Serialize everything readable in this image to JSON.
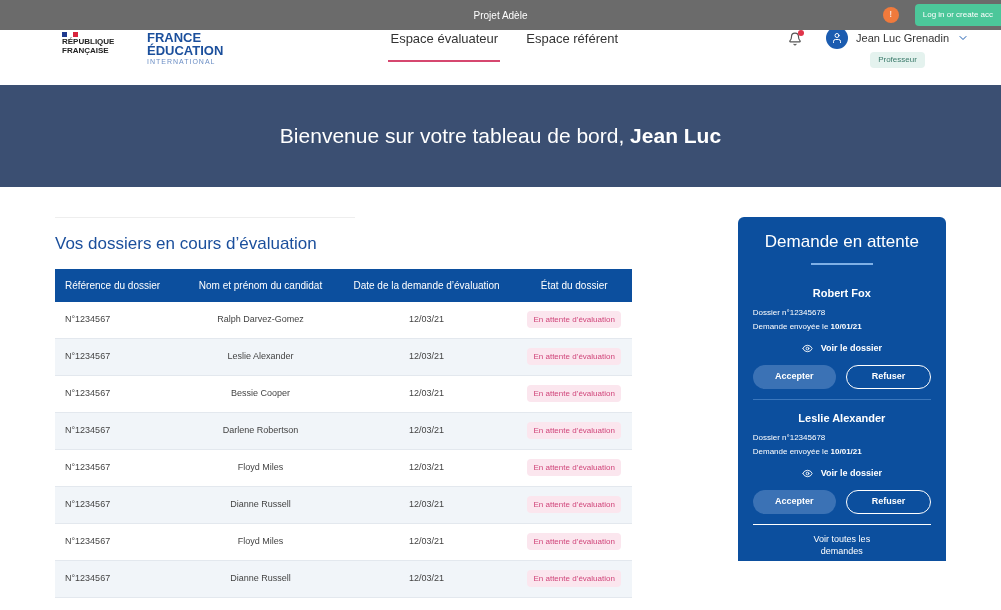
{
  "top_bar": {
    "title": "Projet Adèle",
    "badge": "!",
    "login_button": "Log in or create acc"
  },
  "header": {
    "logo_republique": [
      "RÉPUBLIQUE",
      "FRANÇAISE"
    ],
    "logo_fei": [
      "FRANCE",
      "ÉDUCATION",
      "INTERNATIONAL"
    ],
    "nav": [
      {
        "label": "Espace évaluateur",
        "selected": true
      },
      {
        "label": "Espace référent",
        "selected": false
      }
    ],
    "notifications": {
      "unread": true
    },
    "user": {
      "name": "Jean Luc Grenadin",
      "role": "Professeur"
    }
  },
  "hero": {
    "title": "Bienvenue sur votre tableau de bord, **Jean Luc**"
  },
  "dossiers": {
    "title": "Vos dossiers en cours d’évaluation",
    "columns": [
      "Référence du dossier",
      "Nom et prénom du candidat",
      "Date de la demande d’évaluation",
      "État du dossier"
    ],
    "rows": [
      {
        "ref": "N°1234567",
        "name": "Ralph Darvez-Gomez",
        "date": "12/03/21",
        "status": "En attente d’évaluation"
      },
      {
        "ref": "N°1234567",
        "name": "Leslie Alexander",
        "date": "12/03/21",
        "status": "En attente d’évaluation"
      },
      {
        "ref": "N°1234567",
        "name": "Bessie Cooper",
        "date": "12/03/21",
        "status": "En attente d’évaluation"
      },
      {
        "ref": "N°1234567",
        "name": "Darlene Robertson",
        "date": "12/03/21",
        "status": "En attente d’évaluation"
      },
      {
        "ref": "N°1234567",
        "name": "Floyd Miles",
        "date": "12/03/21",
        "status": "En attente d’évaluation"
      },
      {
        "ref": "N°1234567",
        "name": "Dianne Russell",
        "date": "12/03/21",
        "status": "En attente d’évaluation"
      },
      {
        "ref": "N°1234567",
        "name": "Floyd Miles",
        "date": "12/03/21",
        "status": "En attente d’évaluation"
      },
      {
        "ref": "N°1234567",
        "name": "Dianne Russell",
        "date": "12/03/21",
        "status": "En attente d’évaluation"
      }
    ]
  },
  "pending": {
    "title": "Demande en attente",
    "requests": [
      {
        "name": "Robert Fox",
        "dossier": "Dossier n°12345678",
        "sent": "Demande envoyée le **10/01/21**",
        "view": "Voir le dossier",
        "accept": "Accepter",
        "refuse": "Refuser"
      },
      {
        "name": "Leslie Alexander",
        "dossier": "Dossier n°12345678",
        "sent": "Demande envoyée le **10/01/21**",
        "view": "Voir le dossier",
        "accept": "Accepter",
        "refuse": "Refuser"
      }
    ],
    "see_all": "Voir toutes les demandes"
  }
}
